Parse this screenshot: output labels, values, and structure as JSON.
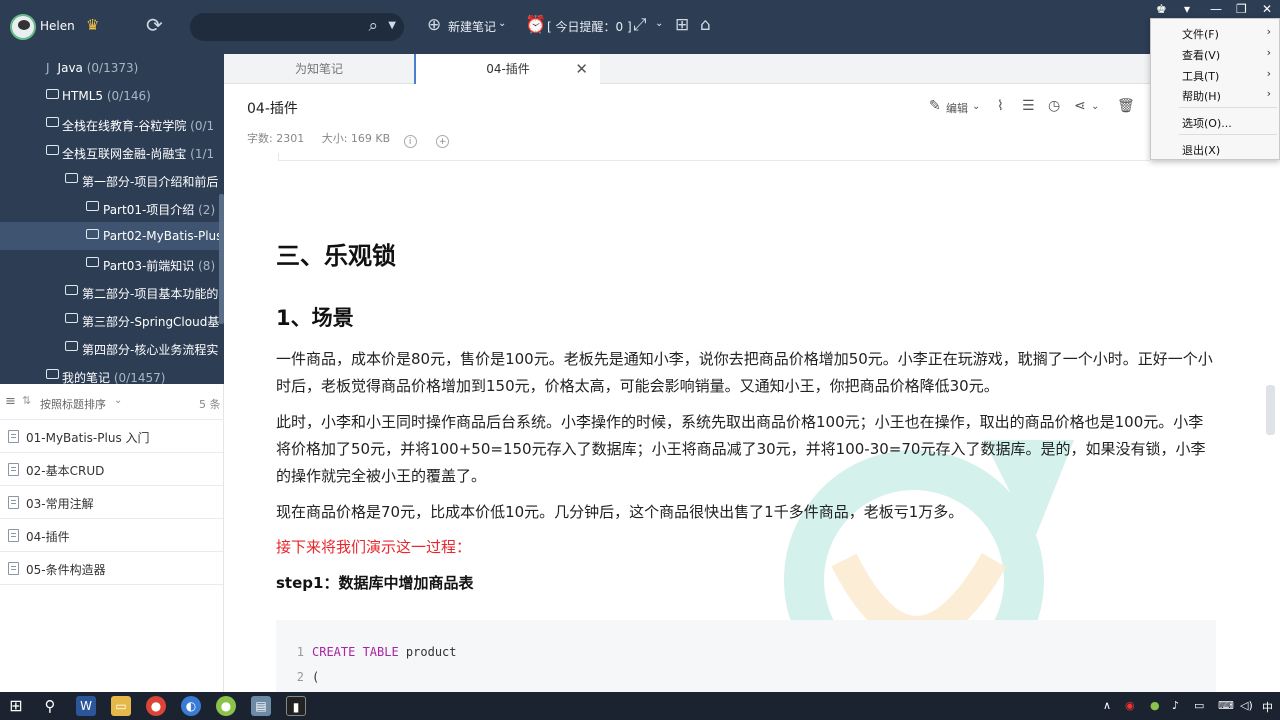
{
  "topbar": {
    "username": "Helen",
    "new_note": "新建笔记",
    "reminder": "[ 今日提醒：0 ]"
  },
  "sidebar": {
    "tree": [
      {
        "label": "Java",
        "count": "(0/1373)"
      },
      {
        "label": "HTML5",
        "count": "(0/146)"
      },
      {
        "label": "全栈在线教育-谷粒学院",
        "count": "(0/1"
      },
      {
        "label": "全栈互联网金融-尚融宝",
        "count": "(1/1"
      },
      {
        "label": "第一部分-项目介绍和前后",
        "count": ""
      },
      {
        "label": "Part01-项目介绍",
        "count": "(2)"
      },
      {
        "label": "Part02-MyBatis-Plus",
        "count": ""
      },
      {
        "label": "Part03-前端知识",
        "count": "(8)"
      },
      {
        "label": "第二部分-项目基本功能的",
        "count": ""
      },
      {
        "label": "第三部分-SpringCloud基",
        "count": ""
      },
      {
        "label": "第四部分-核心业务流程实",
        "count": ""
      },
      {
        "label": "我的笔记",
        "count": "(0/1457)"
      }
    ]
  },
  "list": {
    "sort_label": "按照标题排序",
    "count": "5 条",
    "items": [
      "01-MyBatis-Plus 入门",
      "02-基本CRUD",
      "03-常用注解",
      "04-插件",
      "05-条件构造器"
    ]
  },
  "tabs": [
    "为知笔记",
    "04-插件"
  ],
  "note": {
    "title": "04-插件",
    "word_count": "字数: 2301",
    "size": "大小: 169 KB",
    "edit_label": "编辑"
  },
  "content": {
    "h1": "三、乐观锁",
    "h2": "1、场景",
    "p1": "一件商品，成本价是80元，售价是100元。老板先是通知小李，说你去把商品价格增加50元。小李正在玩游戏，耽搁了一个小时。正好一个小时后，老板觉得商品价格增加到150元，价格太高，可能会影响销量。又通知小王，你把商品价格降低30元。",
    "p2": "此时，小李和小王同时操作商品后台系统。小李操作的时候，系统先取出商品价格100元；小王也在操作，取出的商品价格也是100元。小李将价格加了50元，并将100+50=150元存入了数据库；小王将商品减了30元，并将100-30=70元存入了数据库。是的，如果没有锁，小李的操作就完全被小王的覆盖了。",
    "p3": "现在商品价格是70元，比成本价低10元。几分钟后，这个商品很快出售了1千多件商品，老板亏1万多。",
    "p4": "接下来将我们演示这一过程：",
    "p5": "step1：数据库中增加商品表",
    "code": [
      {
        "ln": "1",
        "kw": "CREATE TABLE",
        "rest": " product"
      },
      {
        "ln": "2",
        "kw": "",
        "rest": "("
      }
    ]
  },
  "menu": {
    "items": [
      "文件(F)",
      "查看(V)",
      "工具(T)",
      "帮助(H)",
      "选项(O)...",
      "退出(X)"
    ]
  },
  "taskbar": {
    "ime": "中"
  }
}
